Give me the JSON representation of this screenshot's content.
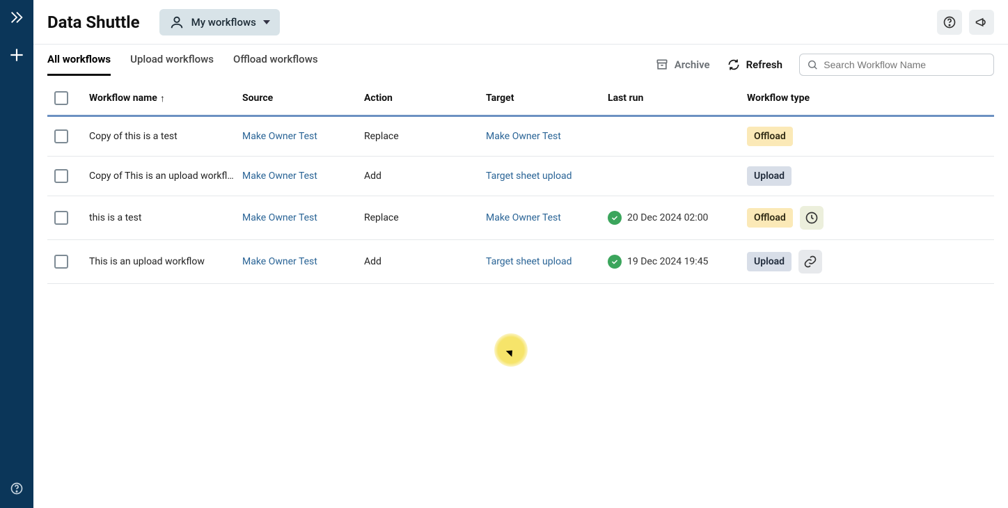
{
  "app": {
    "title": "Data Shuttle"
  },
  "header": {
    "my_workflows_label": "My workflows"
  },
  "toolbar": {
    "archive_label": "Archive",
    "refresh_label": "Refresh",
    "search_placeholder": "Search Workflow Name"
  },
  "tabs": [
    {
      "label": "All workflows",
      "active": true
    },
    {
      "label": "Upload workflows",
      "active": false
    },
    {
      "label": "Offload workflows",
      "active": false
    }
  ],
  "columns": {
    "workflow_name": "Workflow name",
    "source": "Source",
    "action": "Action",
    "target": "Target",
    "last_run": "Last run",
    "workflow_type": "Workflow type"
  },
  "rows": [
    {
      "name": "Copy of this is a test",
      "source": "Make Owner Test",
      "action": "Replace",
      "target": "Make Owner Test",
      "last_run": "",
      "last_run_status": "",
      "type": "Offload",
      "type_icon": ""
    },
    {
      "name": "Copy of This is an upload workflow",
      "source": "Make Owner Test",
      "action": "Add",
      "target": "Target sheet upload",
      "last_run": "",
      "last_run_status": "",
      "type": "Upload",
      "type_icon": ""
    },
    {
      "name": "this is a test",
      "source": "Make Owner Test",
      "action": "Replace",
      "target": "Make Owner Test",
      "last_run": "20 Dec 2024 02:00",
      "last_run_status": "ok",
      "type": "Offload",
      "type_icon": "clock"
    },
    {
      "name": "This is an upload workflow",
      "source": "Make Owner Test",
      "action": "Add",
      "target": "Target sheet upload",
      "last_run": "19 Dec 2024 19:45",
      "last_run_status": "ok",
      "type": "Upload",
      "type_icon": "link"
    }
  ]
}
